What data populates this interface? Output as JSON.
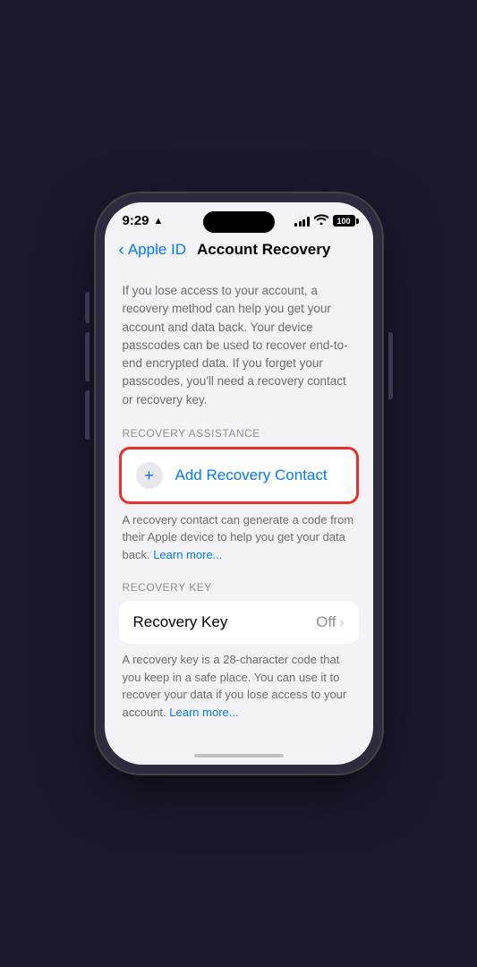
{
  "statusBar": {
    "time": "9:29",
    "locationIcon": "▲",
    "batteryLevel": "100"
  },
  "navigation": {
    "backLabel": "Apple ID",
    "pageTitle": "Account Recovery"
  },
  "descriptionText": "If you lose access to your account, a recovery method can help you get your account and data back. Your device passcodes can be used to recover end-to-end encrypted data. If you forget your passcodes, you'll need a recovery contact or recovery key.",
  "sections": {
    "recoveryAssistance": {
      "sectionLabel": "RECOVERY ASSISTANCE",
      "addContactButton": "Add Recovery Contact",
      "addContactDescription": "A recovery contact can generate a code from their Apple device to help you get your data back.",
      "learnMoreLabel": "Learn more..."
    },
    "recoveryKey": {
      "sectionLabel": "RECOVERY KEY",
      "label": "Recovery Key",
      "value": "Off",
      "description": "A recovery key is a 28-character code that you keep in a safe place. You can use it to recover your data if you lose access to your account.",
      "learnMoreLabel": "Learn more..."
    }
  }
}
